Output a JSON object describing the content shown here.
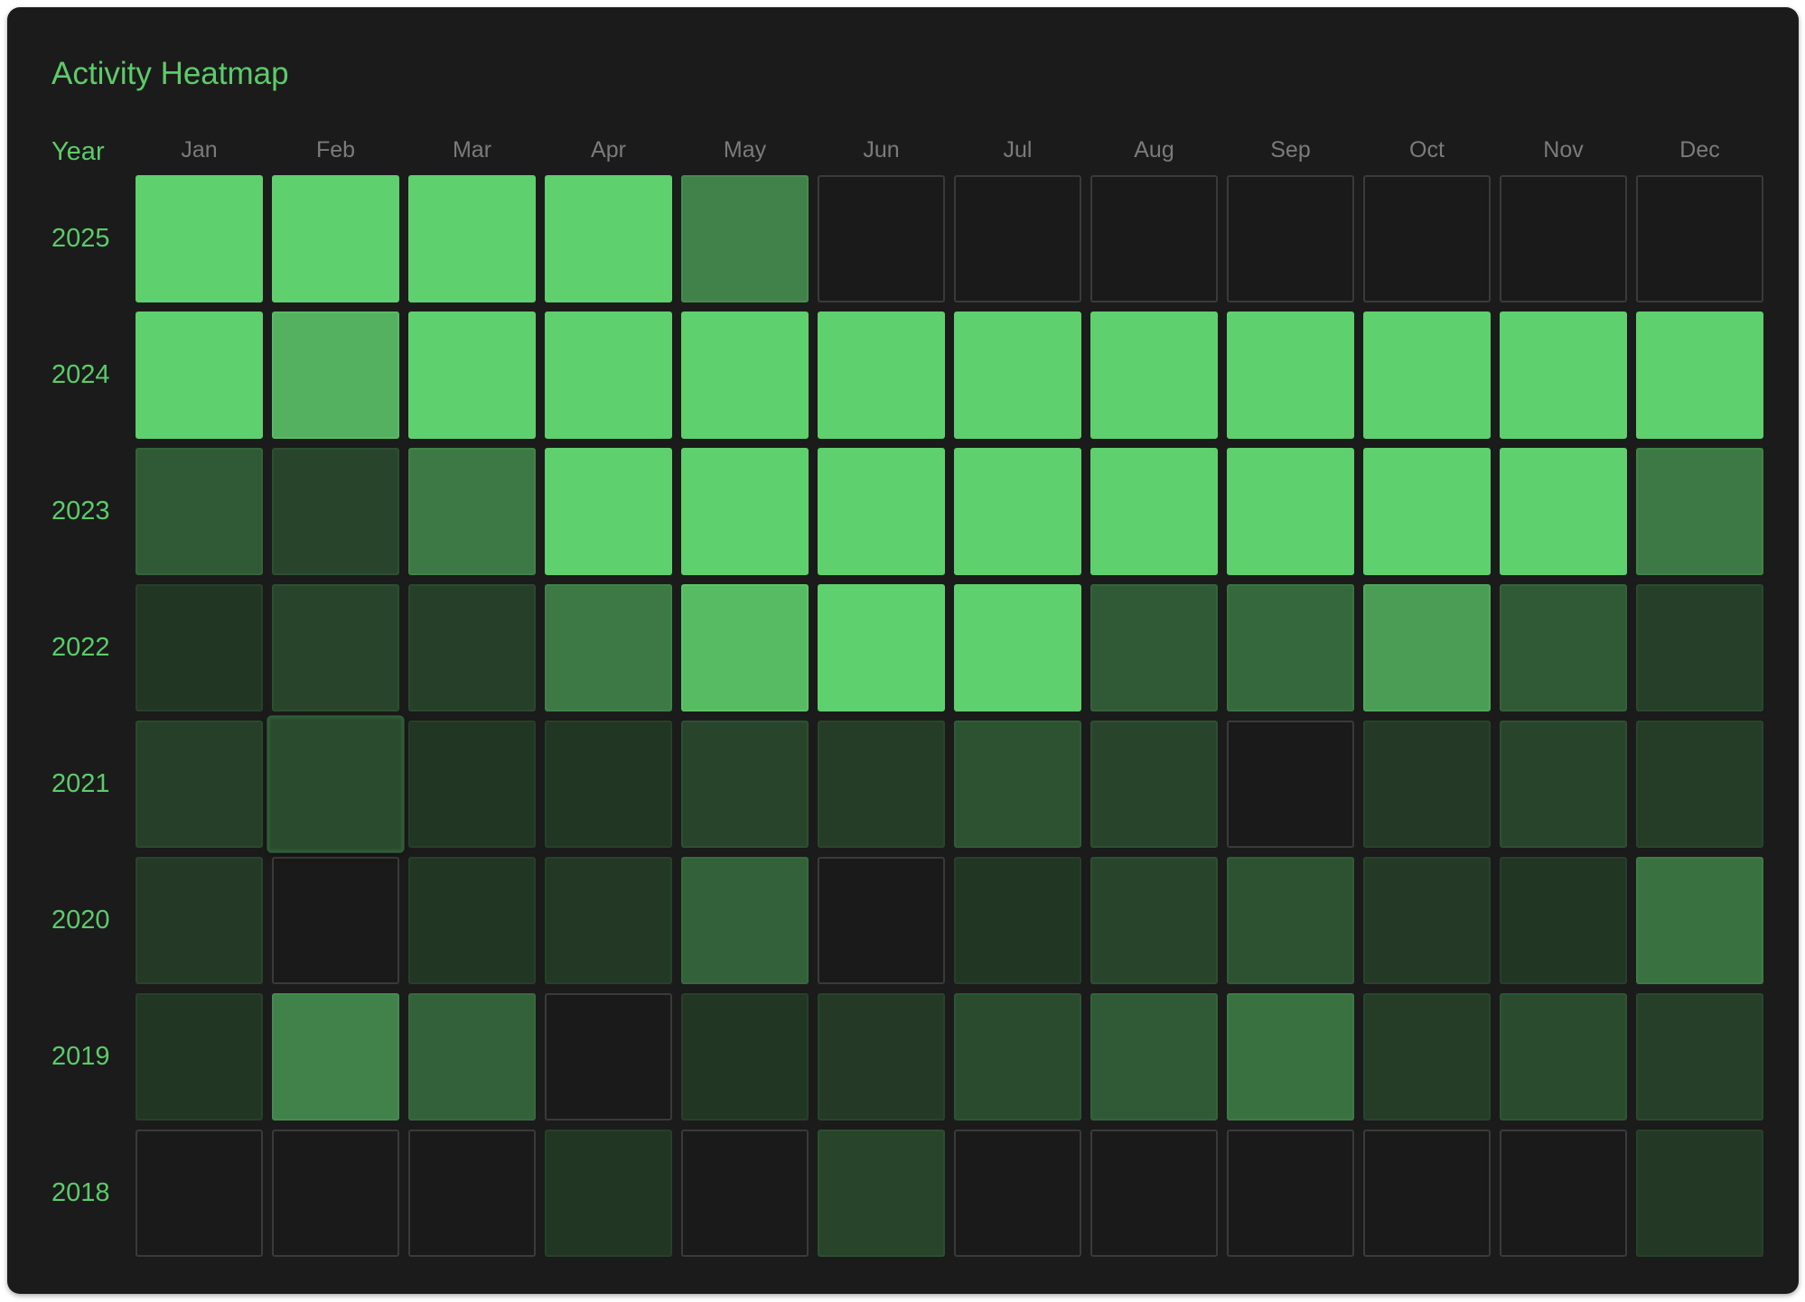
{
  "title": "Activity Heatmap",
  "colors": {
    "accent": "#5ccb6a",
    "card_background": "#1b1b1b",
    "month_label": "#7b7b7b",
    "empty_cell": "#1a1a1a",
    "empty_border": "#3a3a3a",
    "cell_min": "#213323",
    "cell_max": "#5fd06e"
  },
  "chart_data": {
    "type": "heatmap",
    "title": "Activity Heatmap",
    "row_header": "Year",
    "columns": [
      "Jan",
      "Feb",
      "Mar",
      "Apr",
      "May",
      "Jun",
      "Jul",
      "Aug",
      "Sep",
      "Oct",
      "Nov",
      "Dec"
    ],
    "rows": [
      "2025",
      "2024",
      "2023",
      "2022",
      "2021",
      "2020",
      "2019",
      "2018"
    ],
    "scale": "relative intensity 0 to 1 (0 = no activity)",
    "values": [
      [
        1.0,
        1.0,
        1.0,
        1.0,
        0.6,
        0,
        0,
        0,
        0,
        0,
        0,
        0
      ],
      [
        1.0,
        0.85,
        1.0,
        1.0,
        1.0,
        1.0,
        1.0,
        1.0,
        1.0,
        1.0,
        1.0,
        1.0
      ],
      [
        0.35,
        0.2,
        0.55,
        1.0,
        1.0,
        1.0,
        1.0,
        1.0,
        1.0,
        1.0,
        1.0,
        0.55
      ],
      [
        0.05,
        0.2,
        0.15,
        0.55,
        0.9,
        1.0,
        1.0,
        0.35,
        0.45,
        0.75,
        0.35,
        0.15
      ],
      [
        0.15,
        0.25,
        0.05,
        0.05,
        0.2,
        0.12,
        0.3,
        0.2,
        0,
        0.1,
        0.2,
        0.12
      ],
      [
        0.1,
        0,
        0.05,
        0.08,
        0.4,
        0,
        0.05,
        0.2,
        0.3,
        0.1,
        0.05,
        0.5
      ],
      [
        0.05,
        0.6,
        0.4,
        0,
        0.05,
        0.1,
        0.25,
        0.35,
        0.5,
        0.12,
        0.25,
        0.15
      ],
      [
        0,
        0,
        0,
        0.05,
        0,
        0.2,
        0,
        0,
        0,
        0,
        0,
        0.08
      ]
    ],
    "highlighted_cell": {
      "row": "2021",
      "column": "Feb"
    }
  }
}
